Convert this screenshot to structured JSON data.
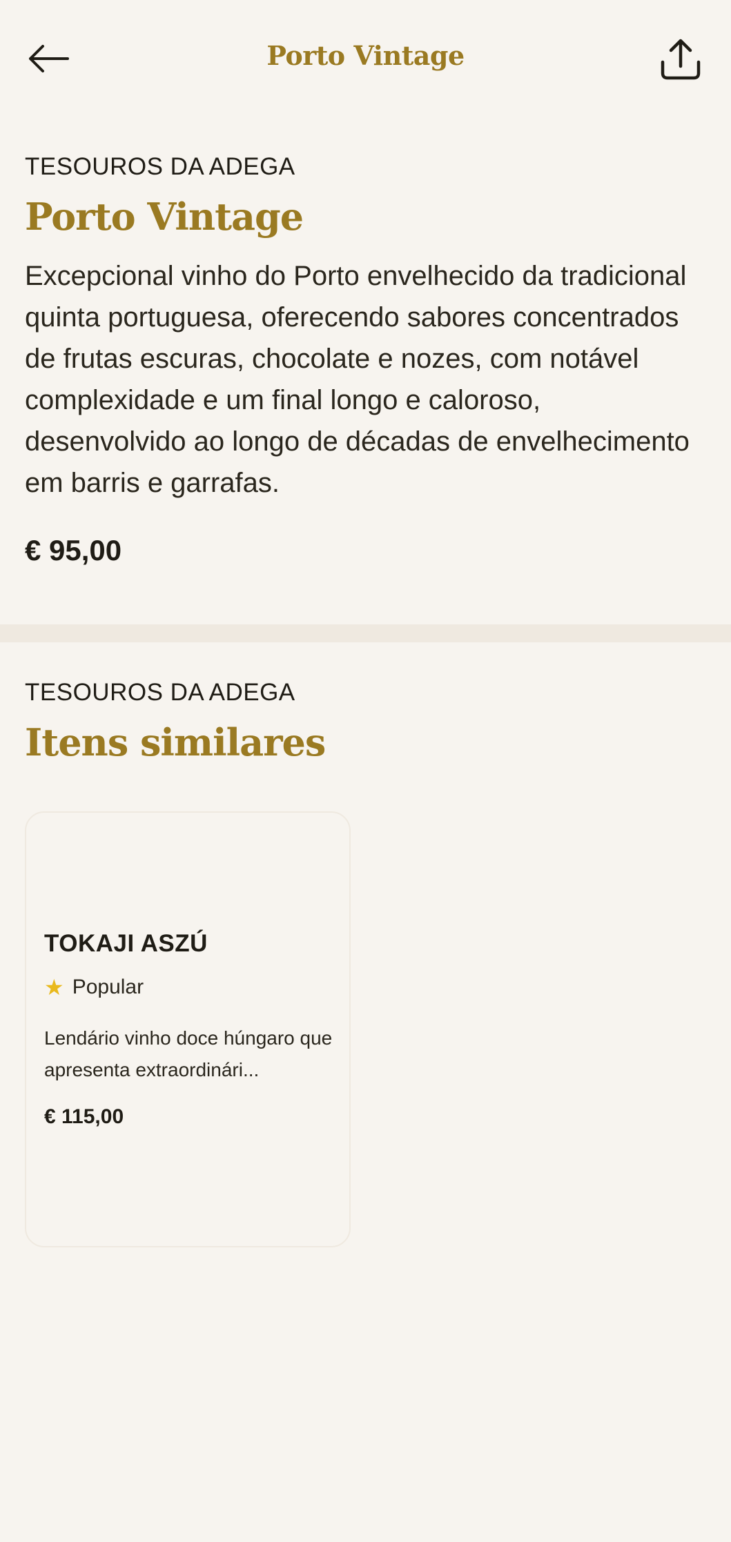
{
  "header": {
    "title": "Porto Vintage",
    "back_icon": "arrow-left-icon",
    "share_icon": "share-icon"
  },
  "product": {
    "eyebrow": "TESOUROS DA ADEGA",
    "name": "Porto Vintage",
    "description": "Excepcional vinho do Porto envelhecido da tradicional quinta portuguesa, oferecendo sabores concentrados de frutas escuras, chocolate e nozes, com notável complexidade e um final longo e caloroso, desenvolvido ao longo de décadas de envelhecimento em barris e garrafas.",
    "price": "€ 95,00"
  },
  "similar": {
    "eyebrow": "TESOUROS DA ADEGA",
    "heading": "Itens similares",
    "items": [
      {
        "name": "TOKAJI ASZÚ",
        "badge": "Popular",
        "badge_icon": "star-icon",
        "description": "Lendário vinho doce húngaro que apresenta extraordinári...",
        "price": "€ 115,00"
      }
    ]
  },
  "colors": {
    "background": "#f7f4ef",
    "accent_gold": "#9a7a22",
    "text_dark": "#1f1c15",
    "star": "#e9b91c",
    "divider": "#efe9e0"
  }
}
